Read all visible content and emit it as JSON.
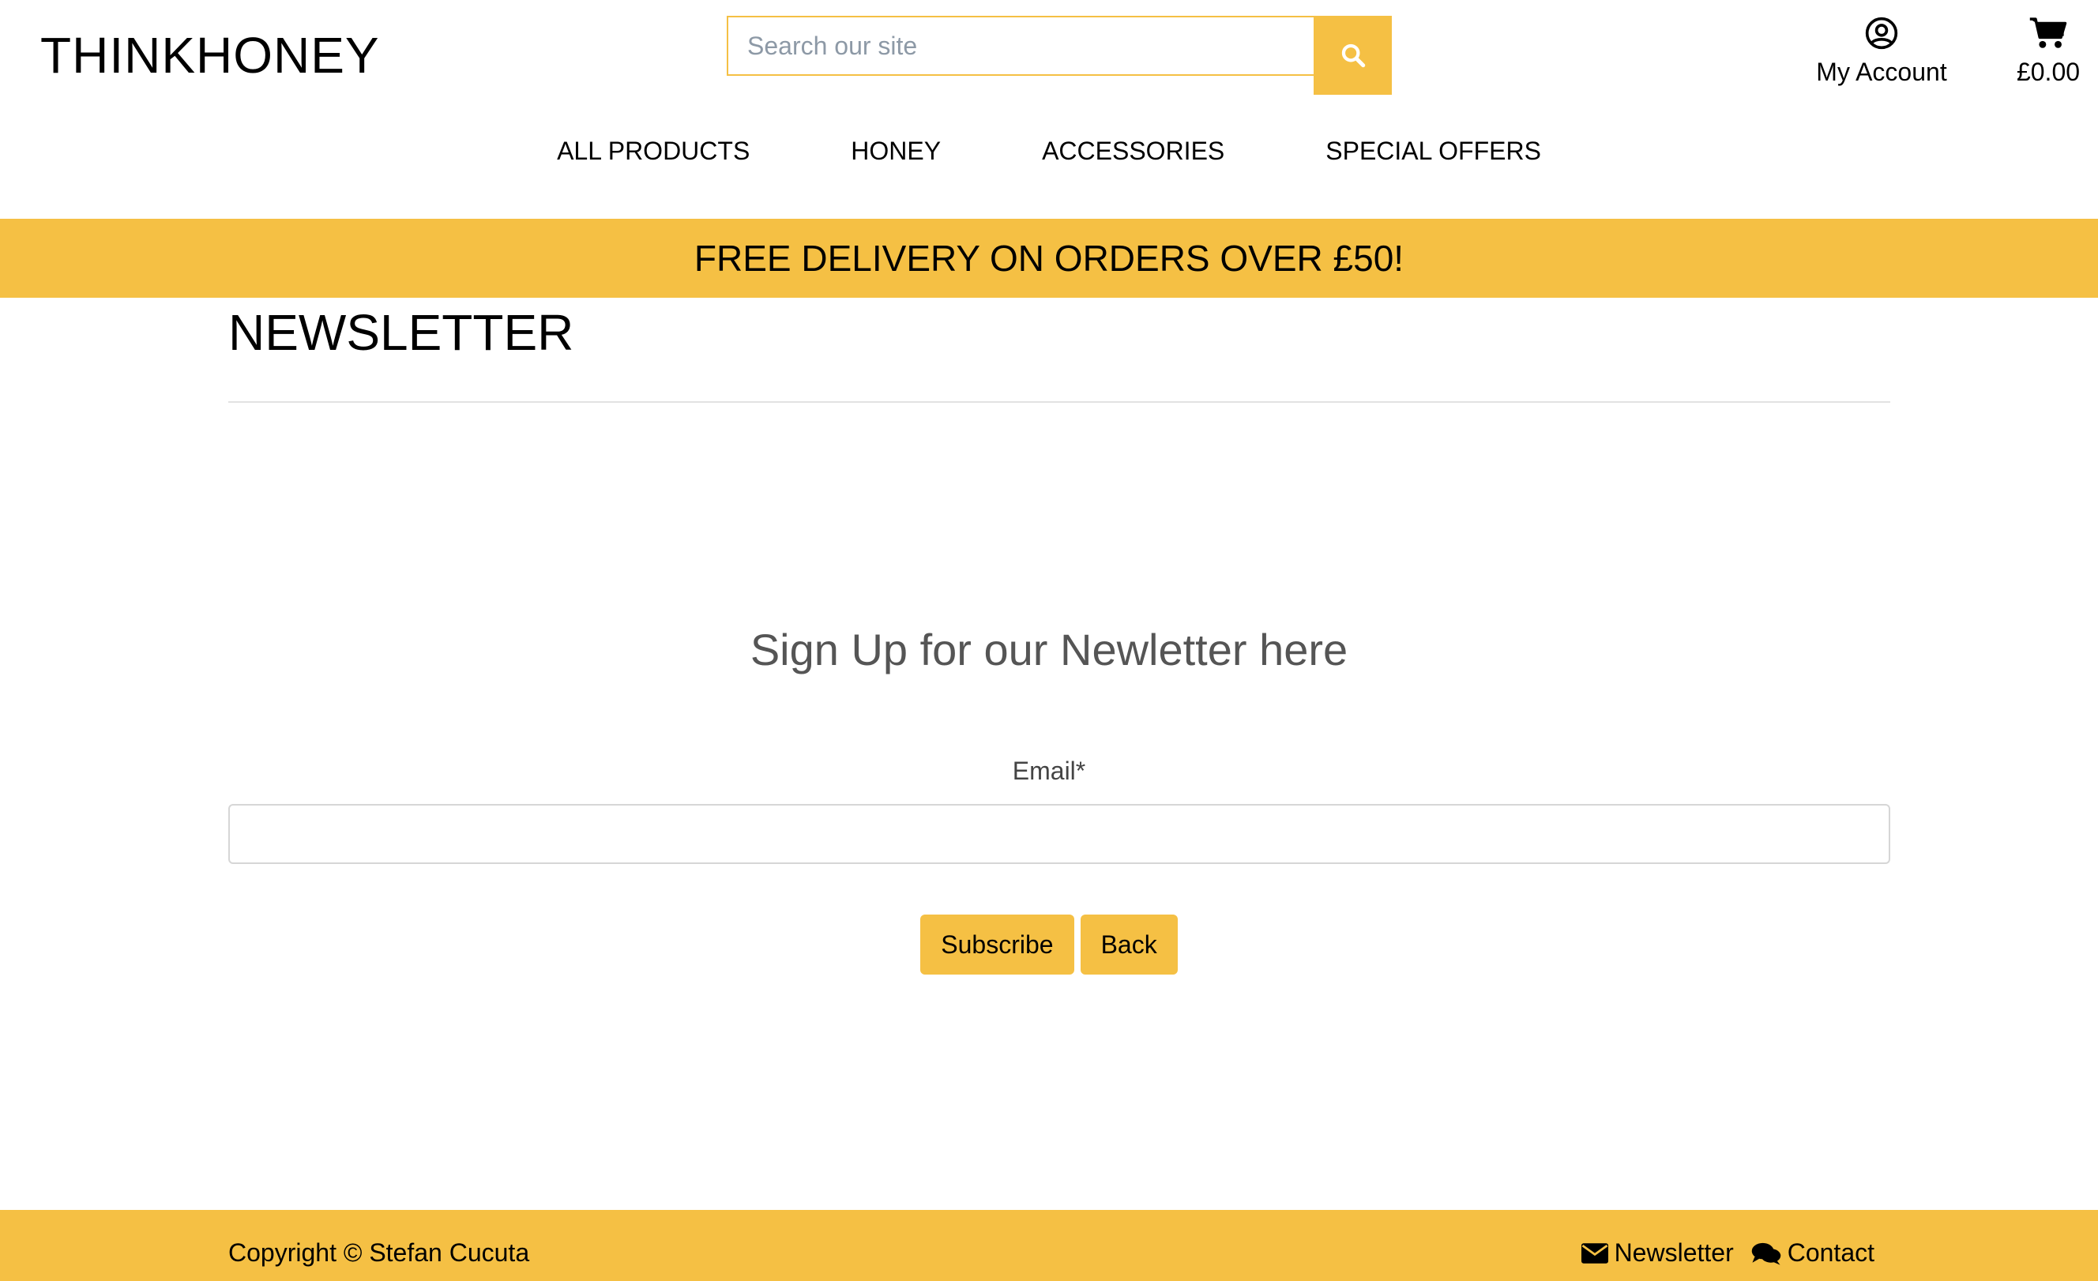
{
  "brand": {
    "name": "THINKHONEY"
  },
  "search": {
    "placeholder": "Search our site",
    "icon": "search-icon"
  },
  "account": {
    "label": "My Account",
    "icon": "user-circle-icon"
  },
  "cart": {
    "total": "£0.00",
    "icon": "shopping-cart-icon"
  },
  "nav": {
    "items": [
      {
        "label": "ALL PRODUCTS"
      },
      {
        "label": "HONEY"
      },
      {
        "label": "ACCESSORIES"
      },
      {
        "label": "SPECIAL OFFERS"
      }
    ]
  },
  "banner": {
    "text": "FREE DELIVERY ON ORDERS OVER £50!"
  },
  "page": {
    "title": "NEWSLETTER",
    "heading": "Sign Up for our Newletter here",
    "email_label": "Email*",
    "email_value": "",
    "subscribe_label": "Subscribe",
    "back_label": "Back"
  },
  "footer": {
    "copyright": "Copyright © Stefan Cucuta",
    "links": [
      {
        "label": "Newsletter",
        "icon": "envelope-icon"
      },
      {
        "label": "Contact",
        "icon": "chat-bubbles-icon"
      }
    ]
  },
  "colors": {
    "accent": "#f5c044",
    "text": "#000000",
    "muted": "#555555",
    "border": "#d6d6d6"
  }
}
